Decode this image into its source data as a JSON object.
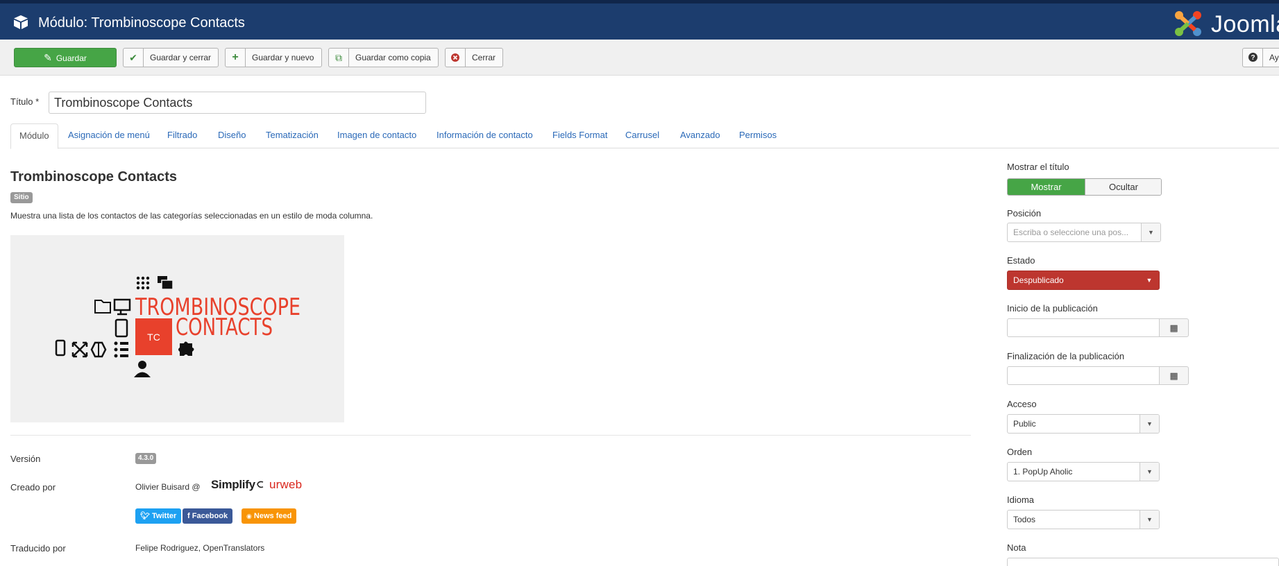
{
  "header": {
    "title": "Módulo: Trombinoscope Contacts",
    "logo_text": "Joomla"
  },
  "toolbar": {
    "save": "Guardar",
    "save_close": "Guardar y cerrar",
    "save_new": "Guardar y nuevo",
    "save_copy": "Guardar como copia",
    "close": "Cerrar",
    "help": "Ayuda"
  },
  "form": {
    "title_label": "Título *",
    "title_value": "Trombinoscope Contacts"
  },
  "tabs": [
    "Módulo",
    "Asignación de menú",
    "Filtrado",
    "Diseño",
    "Tematización",
    "Imagen de contacto",
    "Información de contacto",
    "Fields Format",
    "Carrusel",
    "Avanzado",
    "Permisos"
  ],
  "module": {
    "name": "Trombinoscope Contacts",
    "badge": "Sitio",
    "description": "Muestra una lista de los contactos de las categorías seleccionadas en un estilo de moda columna.",
    "logo": {
      "line1": "TROMBINOSCOPE",
      "line2": "CONTACTS",
      "mark": "TC"
    }
  },
  "info": {
    "version_label": "Versión",
    "version": "4.3.0",
    "created_label": "Creado por",
    "author": "Olivier Buisard @",
    "brand_a": "Simplify",
    "brand_b": "urweb",
    "twitter": "Twitter",
    "facebook": "Facebook",
    "news": "News feed",
    "translated_label": "Traducido por",
    "translators": "Felipe Rodriguez, OpenTranslators"
  },
  "sidebar": {
    "show_title_label": "Mostrar el título",
    "show": "Mostrar",
    "hide": "Ocultar",
    "position_label": "Posición",
    "position_placeholder": "Escriba o seleccione una pos...",
    "status_label": "Estado",
    "status_value": "Despublicado",
    "publish_up_label": "Inicio de la publicación",
    "publish_down_label": "Finalización de la publicación",
    "access_label": "Acceso",
    "access_value": "Public",
    "order_label": "Orden",
    "order_value": "1. PopUp Aholic",
    "language_label": "Idioma",
    "language_value": "Todos",
    "note_label": "Nota"
  },
  "colors": {
    "header_bg": "#1c3d6e",
    "save_green": "#46a546",
    "status_red": "#bd362f",
    "brand_red": "#e8412c",
    "link_blue": "#2a69b8"
  }
}
